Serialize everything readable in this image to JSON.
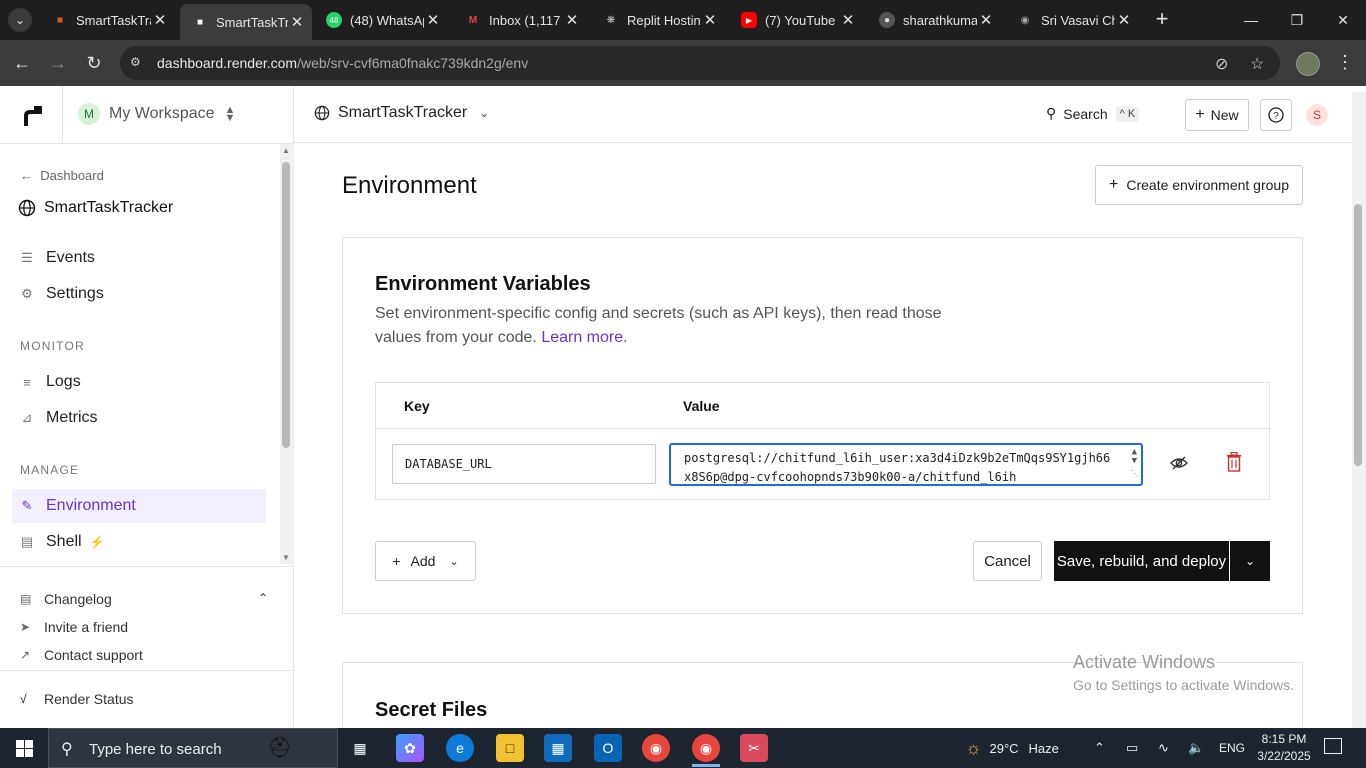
{
  "browser": {
    "tabs": [
      {
        "title": "SmartTaskTra",
        "active": false,
        "fav_color": "#e8571b"
      },
      {
        "title": "SmartTaskTra",
        "active": true,
        "fav_color": "#ffffff"
      },
      {
        "title": "(48) WhatsAp",
        "active": false,
        "fav_color": "#25d366",
        "badge": "48"
      },
      {
        "title": "Inbox (1,117",
        "active": false,
        "fav_color": "#ea4335"
      },
      {
        "title": "Replit Hostin",
        "active": false,
        "fav_color": "#cccccc"
      },
      {
        "title": "(7) YouTube",
        "active": false,
        "fav_color": "#ff0000"
      },
      {
        "title": "sharathkuma",
        "active": false,
        "fav_color": "#888888"
      },
      {
        "title": "Sri Vasavi Ch",
        "active": false,
        "fav_color": "#aaaaaa"
      }
    ],
    "url_host": "dashboard.render.com",
    "url_path": "/web/srv-cvf6ma0fnakc739kdn2g/env"
  },
  "sidebar": {
    "workspace_initial": "M",
    "workspace_name": "My Workspace",
    "back_label": "Dashboard",
    "service_name": "SmartTaskTracker",
    "items_top": [
      {
        "label": "Events",
        "icon": "list-icon"
      },
      {
        "label": "Settings",
        "icon": "gear-icon"
      }
    ],
    "section_monitor": "MONITOR",
    "items_monitor": [
      {
        "label": "Logs",
        "icon": "logs-icon"
      },
      {
        "label": "Metrics",
        "icon": "metrics-icon"
      }
    ],
    "section_manage": "MANAGE",
    "items_manage": [
      {
        "label": "Environment",
        "icon": "environment-icon",
        "active": true
      },
      {
        "label": "Shell",
        "icon": "terminal-icon"
      }
    ],
    "footer": {
      "changelog": "Changelog",
      "invite": "Invite a friend",
      "support": "Contact support",
      "status": "Render Status"
    }
  },
  "topbar": {
    "service_name": "SmartTaskTracker",
    "search_label": "Search",
    "search_kbd": "^ K",
    "new_label": "New",
    "user_initial": "S"
  },
  "main": {
    "title": "Environment",
    "create_group_label": "Create environment group",
    "env_card": {
      "heading": "Environment Variables",
      "description": "Set environment-specific config and secrets (such as API keys), then read those values from your code.",
      "learn_more": "Learn more.",
      "col_key": "Key",
      "col_value": "Value",
      "rows": [
        {
          "key": "DATABASE_URL",
          "value": "postgresql://chitfund_l6ih_user:xa3d4iDzk9b2eTmQqs9SY1gjh66x8S6p@dpg-cvfcoohopnds73b90k00-a/chitfund_l6ih"
        }
      ],
      "add_label": "Add",
      "cancel_label": "Cancel",
      "save_label": "Save, rebuild, and deploy"
    },
    "secret_files_heading": "Secret Files"
  },
  "watermark": {
    "line1": "Activate Windows",
    "line2": "Go to Settings to activate Windows."
  },
  "taskbar": {
    "search_placeholder": "Type here to search",
    "weather_temp": "29°C",
    "weather_desc": "Haze",
    "lang": "ENG",
    "time": "8:15 PM",
    "date": "3/22/2025"
  },
  "colors": {
    "accent": "#6a33d9",
    "danger": "#d32f2f",
    "focus": "#1a6fe0"
  }
}
